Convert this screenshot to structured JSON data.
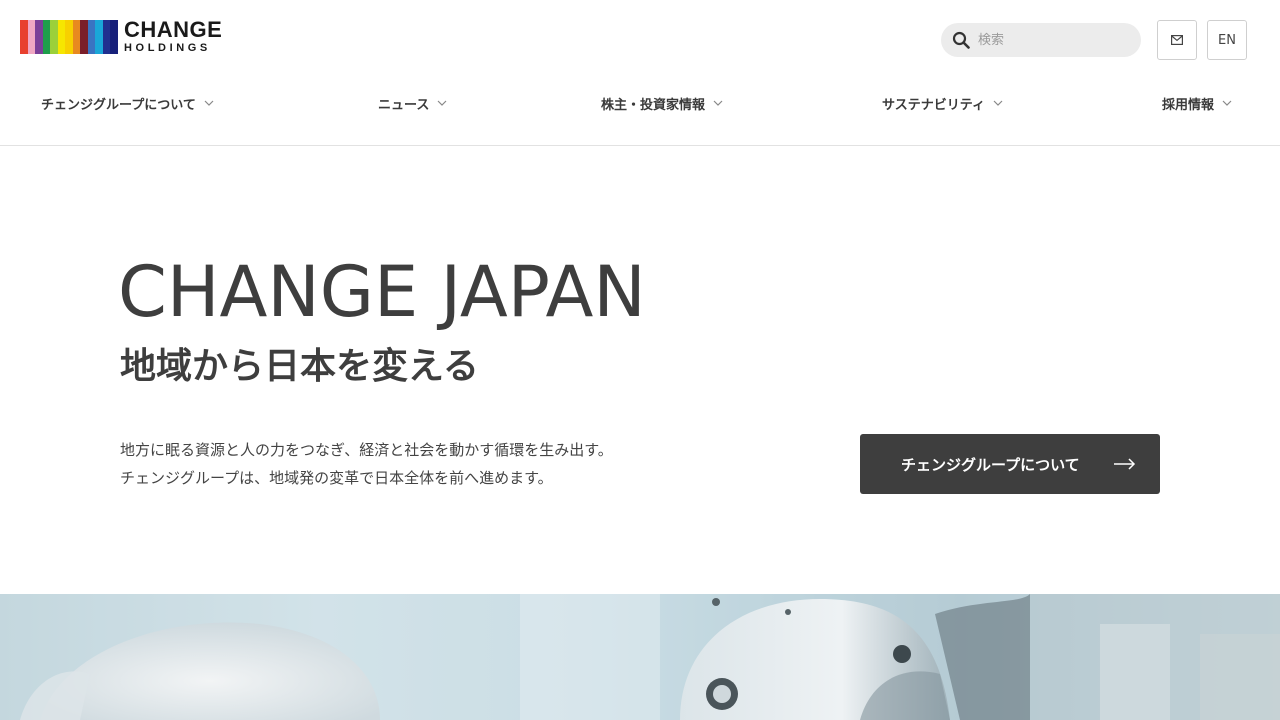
{
  "header": {
    "logo": {
      "main": "CHANGE",
      "sub": "HOLDINGS",
      "stripe_colors": [
        "#e8402e",
        "#f0a7c3",
        "#7b3f98",
        "#1f9e4b",
        "#9bd03a",
        "#f6e600",
        "#f7d000",
        "#e88a1f",
        "#7a1f2a",
        "#3a74c2",
        "#1aa7d8",
        "#20308f",
        "#17207a"
      ]
    },
    "search": {
      "placeholder": "検索",
      "icon": "search-icon"
    },
    "mail_icon": "mail-icon",
    "lang_label": "EN"
  },
  "nav": {
    "items": [
      {
        "label": "チェンジグループについて"
      },
      {
        "label": "ニュース"
      },
      {
        "label": "株主・投資家情報"
      },
      {
        "label": "サステナビリティ"
      },
      {
        "label": "採用情報"
      }
    ]
  },
  "hero": {
    "title": "CHANGE JAPAN",
    "subtitle": "地域から日本を変える",
    "body_lines": [
      "地方に眠る資源と人の力をつなぎ、経済と社会を動かす循環を生み出す。",
      "チェンジグループは、地域発の変革で日本全体を前へ進めます。"
    ],
    "cta_label": "チェンジグループについて"
  },
  "colors": {
    "text": "#3e3e3e",
    "cta_bg": "#3e3e3e",
    "search_bg": "#ececec"
  }
}
